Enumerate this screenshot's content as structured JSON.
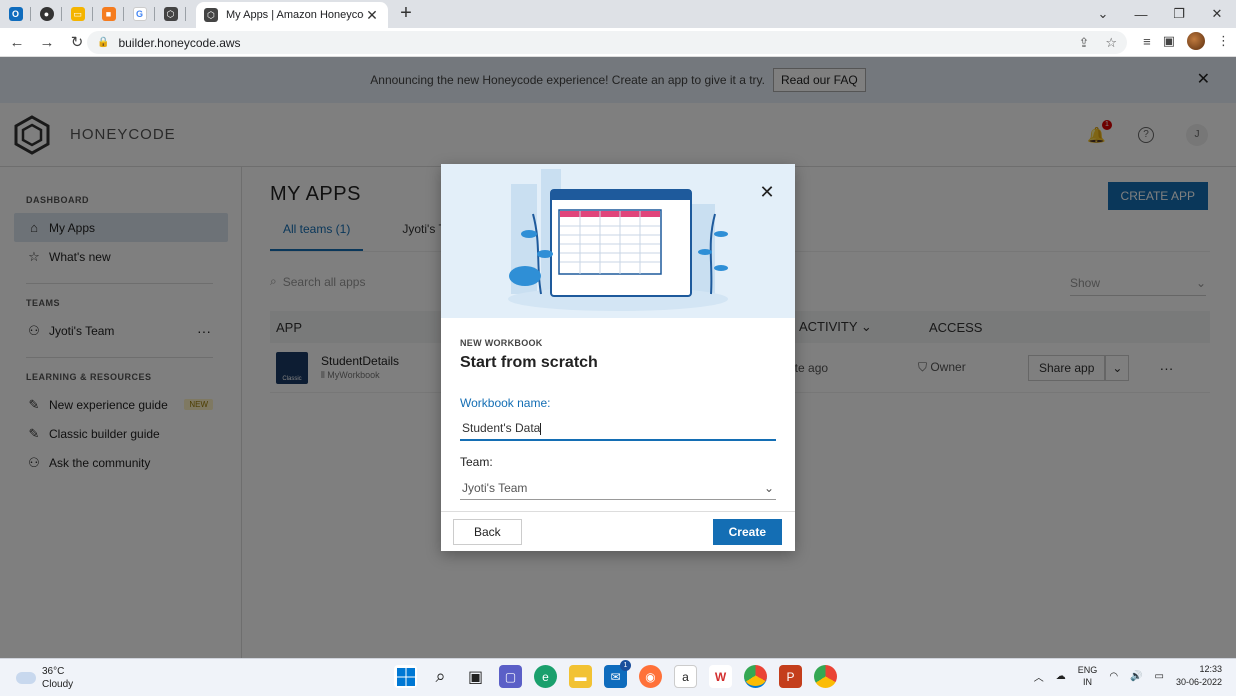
{
  "browser": {
    "active_tab_title": "My Apps | Amazon Honeycode",
    "url": "builder.honeycode.aws",
    "pinned_tabs": [
      {
        "name": "outlook-tab-icon",
        "color": "#0f6cbd",
        "glyph": "O"
      },
      {
        "name": "github-tab-icon",
        "color": "#333333",
        "glyph": "●"
      },
      {
        "name": "slides-tab-icon",
        "color": "#f4b400",
        "glyph": "▭"
      },
      {
        "name": "box-tab-icon",
        "color": "#f57c1f",
        "glyph": "■"
      },
      {
        "name": "google-tab-icon",
        "color": "#4285f4",
        "glyph": "G"
      },
      {
        "name": "honeycode-tab-icon",
        "color": "#444444",
        "glyph": "⬡"
      }
    ]
  },
  "banner": {
    "text": "Announcing the new Honeycode experience! Create an app to give it a try.",
    "faq_label": "Read our FAQ"
  },
  "header": {
    "brand": "HONEYCODE",
    "notification_count": "1",
    "user_initial": "J"
  },
  "sidebar": {
    "dashboard_title": "DASHBOARD",
    "my_apps": "My Apps",
    "whats_new": "What's new",
    "teams_title": "TEAMS",
    "team_name": "Jyoti's Team",
    "learning_title": "LEARNING & RESOURCES",
    "new_experience_guide": "New experience guide",
    "new_badge": "NEW",
    "classic_builder_guide": "Classic builder guide",
    "ask_community": "Ask the community"
  },
  "main": {
    "title": "MY APPS",
    "create_app": "CREATE APP",
    "tab_all_teams": "All teams (1)",
    "tab_team": "Jyoti's Team (",
    "search_placeholder": "Search all apps",
    "show_label": "Show",
    "col_app": "APP",
    "col_activity": "ACTIVITY",
    "col_access": "ACCESS",
    "app_row": {
      "name": "StudentDetails",
      "workbook": "MyWorkbook",
      "icon_label": "Classic",
      "activity": "ute ago",
      "access": "Owner",
      "share_label": "Share app"
    }
  },
  "modal": {
    "eyebrow": "NEW WORKBOOK",
    "title": "Start from scratch",
    "workbook_label": "Workbook name:",
    "workbook_value": "Student's Data",
    "team_label": "Team:",
    "team_value": "Jyoti's Team",
    "back_label": "Back",
    "create_label": "Create"
  },
  "taskbar": {
    "temperature": "36°C",
    "weather": "Cloudy",
    "lang_top": "ENG",
    "lang_bottom": "IN",
    "time": "12:33",
    "date": "30-06-2022",
    "mail_badge": "1"
  }
}
